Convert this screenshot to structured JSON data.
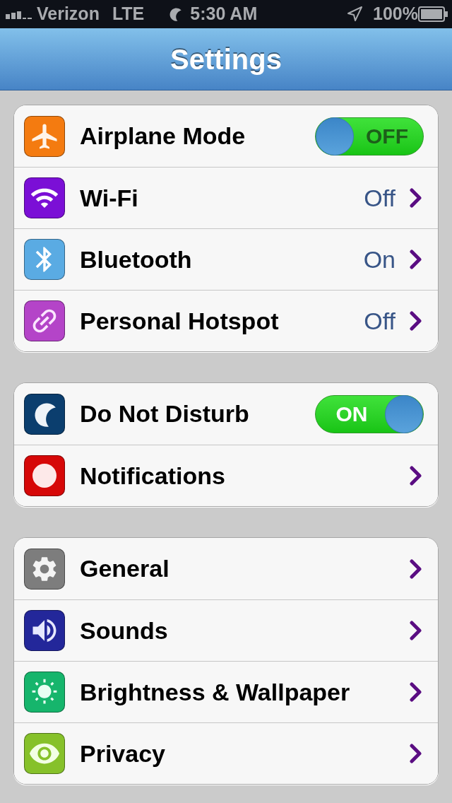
{
  "status_bar": {
    "carrier": "Verizon",
    "network": "LTE",
    "time": "5:30 AM",
    "battery": "100%"
  },
  "nav_bar": {
    "title": "Settings"
  },
  "groups": [
    {
      "rows": [
        {
          "kind": "toggle",
          "label": "Airplane Mode",
          "color": "#f47b10",
          "toggle": {
            "on": false,
            "label": "OFF"
          }
        },
        {
          "kind": "value",
          "label": "Wi-Fi",
          "color": "#7b0fd6",
          "value": "Off"
        },
        {
          "kind": "value",
          "label": "Bluetooth",
          "color": "#5aabe3",
          "value": "On"
        },
        {
          "kind": "value",
          "label": "Personal Hotspot",
          "color": "#b444c8",
          "value": "Off"
        }
      ]
    },
    {
      "rows": [
        {
          "kind": "toggle",
          "label": "Do Not Disturb",
          "color": "#0b3e6e",
          "toggle": {
            "on": true,
            "label": "ON"
          }
        },
        {
          "kind": "link",
          "label": "Notifications",
          "color": "#d60808"
        }
      ]
    },
    {
      "rows": [
        {
          "kind": "link",
          "label": "General",
          "color": "#7d7d7d"
        },
        {
          "kind": "link",
          "label": "Sounds",
          "color": "#23279a"
        },
        {
          "kind": "link",
          "label": "Brightness & Wallpaper",
          "color": "#16b56c"
        },
        {
          "kind": "link",
          "label": "Privacy",
          "color": "#86c12a"
        }
      ]
    }
  ]
}
